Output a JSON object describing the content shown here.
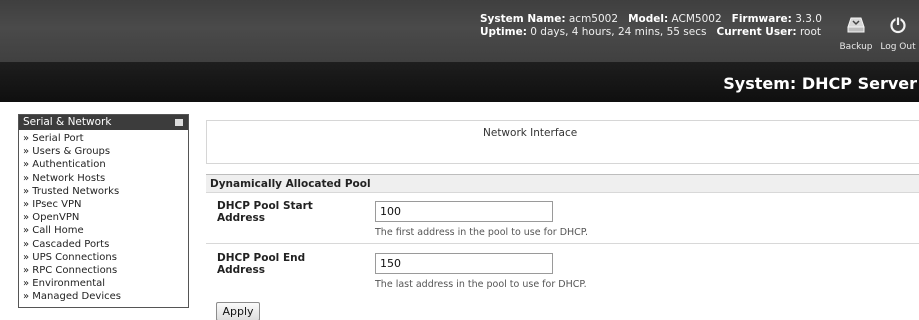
{
  "header": {
    "system_name_label": "System Name:",
    "system_name": "acm5002",
    "model_label": "Model:",
    "model": "ACM5002",
    "firmware_label": "Firmware:",
    "firmware": "3.3.0",
    "uptime_label": "Uptime:",
    "uptime": "0 days, 4 hours, 24 mins, 55 secs",
    "current_user_label": "Current User:",
    "current_user": "root",
    "backup_label": "Backup",
    "logout_label": "Log Out",
    "icons": {
      "backup": "backup-icon",
      "logout": "power-icon"
    }
  },
  "page": {
    "title": "System: DHCP Server"
  },
  "sidebar": {
    "heading": "Serial & Network",
    "items": [
      "» Serial Port",
      "» Users & Groups",
      "» Authentication",
      "» Network Hosts",
      "» Trusted Networks",
      "» IPsec VPN",
      "» OpenVPN",
      "» Call Home",
      "» Cascaded Ports",
      "» UPS Connections",
      "» RPC Connections",
      "» Environmental",
      "» Managed Devices"
    ]
  },
  "main": {
    "network_interface_label": "Network Interface",
    "section_title": "Dynamically Allocated Pool",
    "fields": [
      {
        "label_line1": "DHCP Pool Start",
        "label_line2": "Address",
        "value": "100",
        "help": "The first address in the pool to use for DHCP."
      },
      {
        "label_line1": "DHCP Pool End",
        "label_line2": "Address",
        "value": "150",
        "help": "The last address in the pool to use for DHCP."
      }
    ],
    "apply_label": "Apply"
  }
}
